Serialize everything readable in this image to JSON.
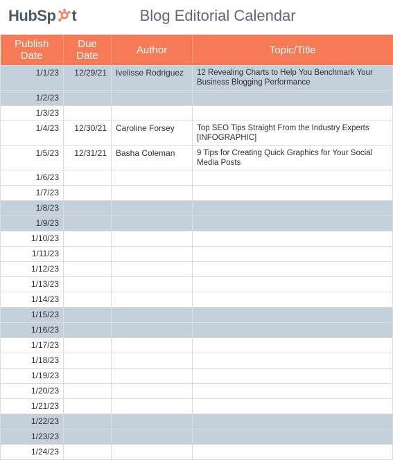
{
  "logo": {
    "text": "HubSp",
    "suffix": "t"
  },
  "title": "Blog Editorial Calendar",
  "headers": {
    "publish": "Publish Date",
    "due": "Due Date",
    "author": "Author",
    "topic": "Topic/Title"
  },
  "rows": [
    {
      "shaded": true,
      "tall": true,
      "publish": "1/1/23",
      "due": "12/29/21",
      "author": "Ivelisse Rodriguez",
      "topic": "12 Revealing Charts to Help You Benchmark Your Business Blogging Performance"
    },
    {
      "shaded": true,
      "publish": "1/2/23",
      "due": "",
      "author": "",
      "topic": ""
    },
    {
      "shaded": false,
      "publish": "1/3/23",
      "due": "",
      "author": "",
      "topic": ""
    },
    {
      "shaded": false,
      "tall": true,
      "publish": "1/4/23",
      "due": "12/30/21",
      "author": "Caroline Forsey",
      "topic": "Top SEO Tips Straight From the Industry Experts [INFOGRAPHIC]"
    },
    {
      "shaded": false,
      "tall": true,
      "publish": "1/5/23",
      "due": "12/31/21",
      "author": "Basha Coleman",
      "topic": "9 Tips for Creating Quick Graphics for Your Social Media Posts"
    },
    {
      "shaded": false,
      "publish": "1/6/23",
      "due": "",
      "author": "",
      "topic": ""
    },
    {
      "shaded": false,
      "publish": "1/7/23",
      "due": "",
      "author": "",
      "topic": ""
    },
    {
      "shaded": true,
      "publish": "1/8/23",
      "due": "",
      "author": "",
      "topic": ""
    },
    {
      "shaded": true,
      "publish": "1/9/23",
      "due": "",
      "author": "",
      "topic": ""
    },
    {
      "shaded": false,
      "publish": "1/10/23",
      "due": "",
      "author": "",
      "topic": ""
    },
    {
      "shaded": false,
      "publish": "1/11/23",
      "due": "",
      "author": "",
      "topic": ""
    },
    {
      "shaded": false,
      "publish": "1/12/23",
      "due": "",
      "author": "",
      "topic": ""
    },
    {
      "shaded": false,
      "publish": "1/13/23",
      "due": "",
      "author": "",
      "topic": ""
    },
    {
      "shaded": false,
      "publish": "1/14/23",
      "due": "",
      "author": "",
      "topic": ""
    },
    {
      "shaded": true,
      "publish": "1/15/23",
      "due": "",
      "author": "",
      "topic": ""
    },
    {
      "shaded": true,
      "publish": "1/16/23",
      "due": "",
      "author": "",
      "topic": ""
    },
    {
      "shaded": false,
      "publish": "1/17/23",
      "due": "",
      "author": "",
      "topic": ""
    },
    {
      "shaded": false,
      "publish": "1/18/23",
      "due": "",
      "author": "",
      "topic": ""
    },
    {
      "shaded": false,
      "publish": "1/19/23",
      "due": "",
      "author": "",
      "topic": ""
    },
    {
      "shaded": false,
      "publish": "1/20/23",
      "due": "",
      "author": "",
      "topic": ""
    },
    {
      "shaded": false,
      "publish": "1/21/23",
      "due": "",
      "author": "",
      "topic": ""
    },
    {
      "shaded": true,
      "publish": "1/22/23",
      "due": "",
      "author": "",
      "topic": ""
    },
    {
      "shaded": true,
      "publish": "1/23/23",
      "due": "",
      "author": "",
      "topic": ""
    },
    {
      "shaded": false,
      "publish": "1/24/23",
      "due": "",
      "author": "",
      "topic": ""
    }
  ]
}
